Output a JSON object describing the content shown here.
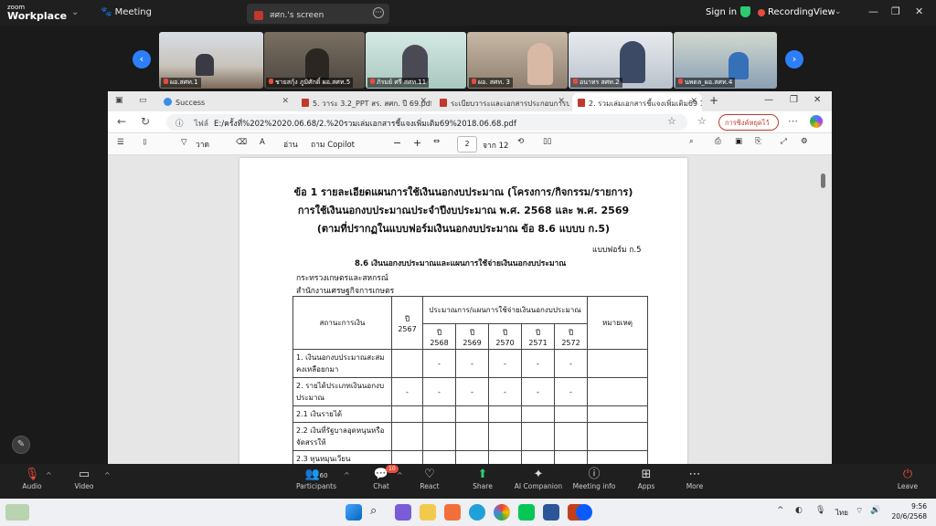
{
  "zoom": {
    "logo_small": "zoom",
    "logo_big": "Workplace",
    "meeting_tab": "Meeting",
    "screen_tab": "สศก.'s screen",
    "sign_in": "Sign in",
    "recording": "Recording",
    "view": "View",
    "participant_names": [
      "ผอ.สศท.1",
      "ชายสกุ้ง ภูมิศักดิ์ ผอ.สศท.5",
      "ภิรมย์ ศรี สศท.11",
      "ผอ. สศท. 3",
      "อนาทร สศท.2",
      "นพดล_ผอ.สศท.4"
    ]
  },
  "browser": {
    "tabs": [
      {
        "label": "Success",
        "icon": "globe-icon"
      },
      {
        "label": "5. วาระ 3.2_PPT สร. สศก. ปี 69.pdf",
        "icon": "pdf-icon"
      },
      {
        "label": "ระเบียบวาระและเอกสารประกอบการประชุมฯ",
        "icon": "pdf-icon"
      },
      {
        "label": "2. รวมเล่มเอกสารชี้แจงเพิ่มเติม69 18.06...",
        "icon": "pdf-icon"
      }
    ],
    "url_site": "ไฟล์",
    "url": "E:/ครั้งที่%202%2020.06.68/2.%20รวมเล่มเอกสารชี้แจงเพิ่มเติม69%2018.06.68.pdf",
    "sync_button": "การซิงค์หยุดไว้",
    "pdf_toolbar": {
      "draw_label": "วาด",
      "read_label": "อ่าน",
      "copilot_label": "ถาม Copilot",
      "page_current": "2",
      "page_total": "จาก 12"
    }
  },
  "document": {
    "title1": "ข้อ 1 รายละเอียดแผนการใช้เงินนอกงบประมาณ (โครงการ/กิจกรรม/รายการ)",
    "title2": "การใช้เงินนอกงบประมาณประจำปีงบประมาณ พ.ศ. 2568 และ พ.ศ. 2569",
    "title3": "(ตามที่ปรากฏในแบบฟอร์มเงินนอกงบประมาณ ข้อ 8.6 แบบบ ก.5)",
    "form_label": "แบบฟอร์ม ก.5",
    "section": "8.6  เงินนอกงบประมาณและแผนการใช้จ่ายเงินนอกงบประมาณ",
    "ministry": "กระทรวงเกษตรและสหกรณ์",
    "office": "สำนักงานเศรษฐกิจการเกษตร",
    "table": {
      "col_status": "สถานะการเงิน",
      "col_year": "ปี",
      "col_year_val": "2567",
      "col_plan": "ประมาณการ/แผนการใช้จ่ายเงินนอกงบประมาณ",
      "col_remark": "หมายเหตุ",
      "plan_years": [
        {
          "label": "ปี",
          "year": "2568"
        },
        {
          "label": "ปี",
          "year": "2569"
        },
        {
          "label": "ปี",
          "year": "2570"
        },
        {
          "label": "ปี",
          "year": "2571"
        },
        {
          "label": "ปี",
          "year": "2572"
        }
      ],
      "rows": [
        {
          "label": "1. เงินนอกงบประมาณสะสมคงเหลือยกมา",
          "y2567": "",
          "vals": [
            "-",
            "-",
            "-",
            "-",
            "-"
          ],
          "remark": ""
        },
        {
          "label": "2. รายได้ประเภทเงินนอกงบประมาณ",
          "y2567": "-",
          "vals": [
            "-",
            "-",
            "-",
            "-",
            "-"
          ],
          "remark": ""
        },
        {
          "label": "2.1 เงินรายได้",
          "y2567": "",
          "vals": [
            "",
            "",
            "",
            "",
            ""
          ],
          "remark": ""
        },
        {
          "label": "2.2 เงินที่รัฐบาลอุดหนุนหรือจัดสรรให้",
          "y2567": "",
          "vals": [
            "",
            "",
            "",
            "",
            ""
          ],
          "remark": ""
        },
        {
          "label": "2.3 ทุนหมุนเวียน",
          "y2567": "",
          "vals": [
            "",
            "",
            "",
            "",
            ""
          ],
          "remark": ""
        }
      ]
    }
  },
  "toolbar": {
    "audio": "Audio",
    "video": "Video",
    "participants": "Participants",
    "participants_count": "60",
    "chat": "Chat",
    "chat_badge": "10",
    "react": "React",
    "share": "Share",
    "ai_companion": "AI Companion",
    "meeting_info": "Meeting info",
    "apps": "Apps",
    "more": "More",
    "leave": "Leave"
  },
  "taskbar": {
    "lang": "ไทย",
    "time": "9:56",
    "date": "20/6/2568"
  }
}
